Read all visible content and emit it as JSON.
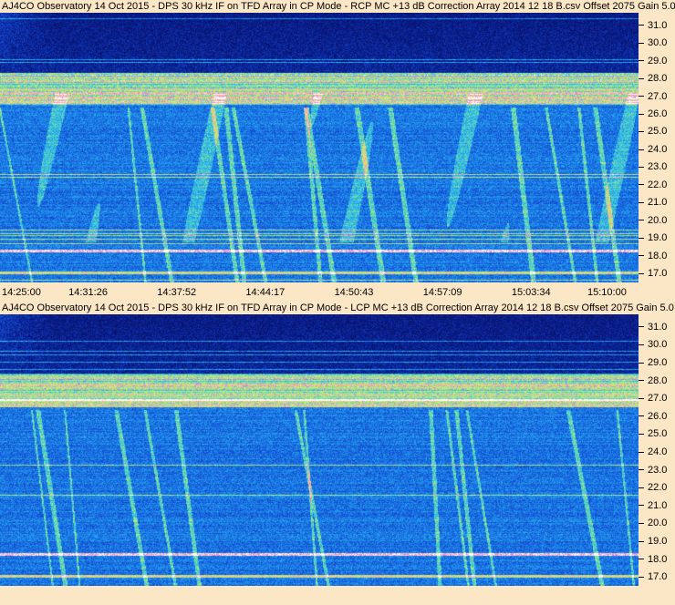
{
  "chart_data": [
    {
      "type": "heatmap",
      "title": "AJ4CO Observatory 14 Oct 2015 - DPS 30 kHz IF on TFD Array in CP Mode - RCP  MC +13 dB  Correction Array 2014 12 18 B.csv  Offset 2075  Gain 5.0",
      "y_ticks": [
        "31.0",
        "30.0",
        "29.0",
        "28.0",
        "27.0",
        "26.0",
        "25.0",
        "24.0",
        "23.0",
        "22.0",
        "21.0",
        "20.0",
        "19.0",
        "18.0",
        "17.0"
      ],
      "x_ticks": [
        "14:25:00",
        "14:31:26",
        "14:37:52",
        "14:44:17",
        "14:50:43",
        "14:57:09",
        "15:03:34",
        "15:10:00"
      ],
      "ylim": [
        16.5,
        31.7
      ],
      "xlim": [
        "14:25:00",
        "15:10:00"
      ]
    },
    {
      "type": "heatmap",
      "title": "AJ4CO Observatory 14 Oct 2015 - DPS 30 kHz IF on TFD Array in CP Mode - LCP  MC +13 dB  Correction Array 2014 12 18 B.csv  Offset 2075  Gain 5.0",
      "y_ticks": [
        "31.0",
        "30.0",
        "29.0",
        "28.0",
        "27.0",
        "26.0",
        "25.0",
        "24.0",
        "23.0",
        "22.0",
        "21.0",
        "20.0",
        "19.0",
        "18.0",
        "17.0"
      ],
      "ylim": [
        16.5,
        31.7
      ]
    }
  ],
  "colors": {
    "background": "#fbe6c6",
    "deep": "#0a1a7a",
    "mid": "#1a5cd8",
    "cyan": "#22b8e8",
    "green": "#8fe07a",
    "magenta": "#e040c0"
  }
}
